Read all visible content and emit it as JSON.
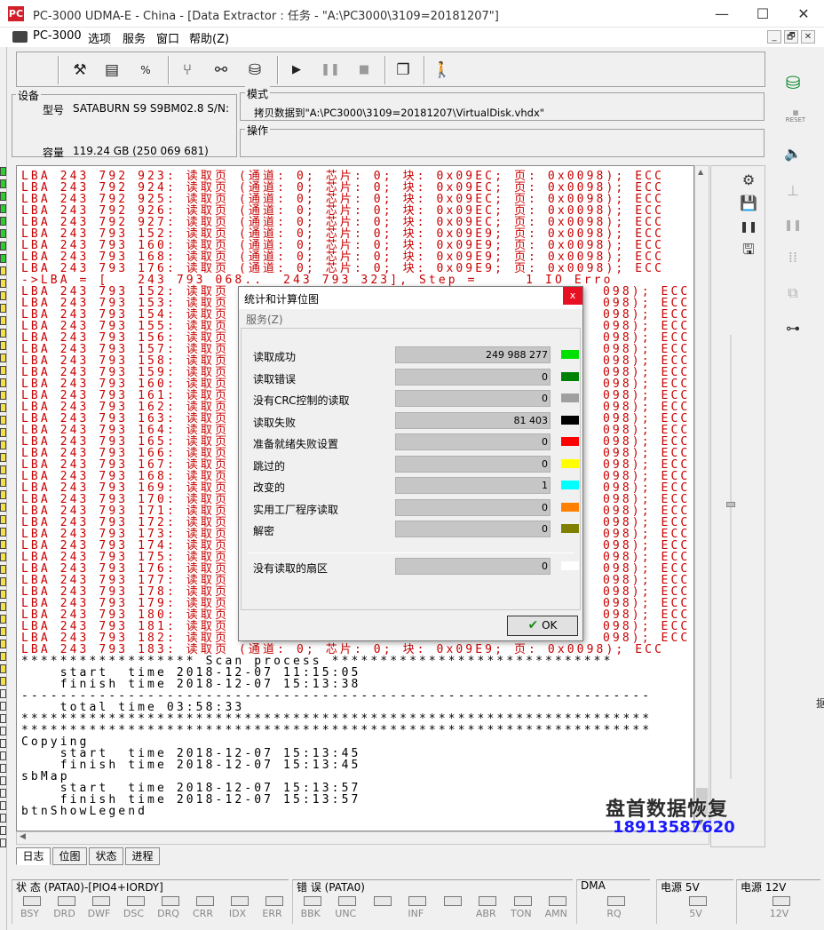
{
  "window": {
    "app_icon": "PC",
    "title": "PC-3000 UDMA-E - China - [Data Extractor : 任务 - \"A:\\PC3000\\3109=20181207\"]",
    "minimize": "—",
    "maximize": "☐",
    "close": "✕"
  },
  "menu": {
    "items": [
      "PC-3000",
      "选项",
      "服务",
      "窗口",
      "帮助(Z)"
    ],
    "mdi_buttons": [
      "_",
      "🗗",
      "✕"
    ]
  },
  "toolbar": {
    "icons": [
      "tools-icon",
      "save-disk-icon",
      "percent-icon",
      "fork-icon",
      "binoculars-icon",
      "disk-arrow-icon",
      "play-icon",
      "pause-icon",
      "stop-icon",
      "windows-icon",
      "walker-icon"
    ]
  },
  "device": {
    "group_label": "设备",
    "model_label": "型号",
    "model_value": "SATABURN   S9 S9BM02.8 S/N:",
    "capacity_label": "容量",
    "capacity_value": "119.24 GB (250 069 681)"
  },
  "mode": {
    "group_label": "模式",
    "text": "拷贝数据到\"A:\\PC3000\\3109=20181207\\VirtualDisk.vhdx\""
  },
  "operation": {
    "group_label": "操作"
  },
  "log": {
    "lines": [
      {
        "text": "LBA 243 792 923: 读取页 (通道: 0; 芯片: 0; 块: 0x09EC; 页: 0x0098); ECC",
        "color": "red"
      },
      {
        "text": "LBA 243 792 924: 读取页 (通道: 0; 芯片: 0; 块: 0x09EC; 页: 0x0098); ECC",
        "color": "red"
      },
      {
        "text": "LBA 243 792 925: 读取页 (通道: 0; 芯片: 0; 块: 0x09EC; 页: 0x0098); ECC",
        "color": "red"
      },
      {
        "text": "LBA 243 792 926: 读取页 (通道: 0; 芯片: 0; 块: 0x09EC; 页: 0x0098); ECC",
        "color": "red"
      },
      {
        "text": "LBA 243 792 927: 读取页 (通道: 0; 芯片: 0; 块: 0x09EC; 页: 0x0098); ECC",
        "color": "red"
      },
      {
        "text": "LBA 243 793 152: 读取页 (通道: 0; 芯片: 0; 块: 0x09E9; 页: 0x0098); ECC",
        "color": "red"
      },
      {
        "text": "LBA 243 793 160: 读取页 (通道: 0; 芯片: 0; 块: 0x09E9; 页: 0x0098); ECC",
        "color": "red"
      },
      {
        "text": "LBA 243 793 168: 读取页 (通道: 0; 芯片: 0; 块: 0x09E9; 页: 0x0098); ECC",
        "color": "red"
      },
      {
        "text": "LBA 243 793 176: 读取页 (通道: 0; 芯片: 0; 块: 0x09E9; 页: 0x0098); ECC",
        "color": "red"
      },
      {
        "text": "->LBA = [   243 793 068..  243 793 323], Step =     1 IO Erro",
        "color": "red"
      },
      {
        "text": "LBA 243 793 152: 读取页",
        "color": "red",
        "tail": "098); ECC"
      },
      {
        "text": "LBA 243 793 153: 读取页",
        "color": "red",
        "tail": "098); ECC"
      },
      {
        "text": "LBA 243 793 154: 读取页",
        "color": "red",
        "tail": "098); ECC"
      },
      {
        "text": "LBA 243 793 155: 读取页",
        "color": "red",
        "tail": "098); ECC"
      },
      {
        "text": "LBA 243 793 156: 读取页",
        "color": "red",
        "tail": "098); ECC"
      },
      {
        "text": "LBA 243 793 157: 读取页",
        "color": "red",
        "tail": "098); ECC"
      },
      {
        "text": "LBA 243 793 158: 读取页",
        "color": "red",
        "tail": "098); ECC"
      },
      {
        "text": "LBA 243 793 159: 读取页",
        "color": "red",
        "tail": "098); ECC"
      },
      {
        "text": "LBA 243 793 160: 读取页",
        "color": "red",
        "tail": "098); ECC"
      },
      {
        "text": "LBA 243 793 161: 读取页",
        "color": "red",
        "tail": "098); ECC"
      },
      {
        "text": "LBA 243 793 162: 读取页",
        "color": "red",
        "tail": "098); ECC"
      },
      {
        "text": "LBA 243 793 163: 读取页",
        "color": "red",
        "tail": "098); ECC"
      },
      {
        "text": "LBA 243 793 164: 读取页",
        "color": "red",
        "tail": "098); ECC"
      },
      {
        "text": "LBA 243 793 165: 读取页",
        "color": "red",
        "tail": "098); ECC"
      },
      {
        "text": "LBA 243 793 166: 读取页",
        "color": "red",
        "tail": "098); ECC"
      },
      {
        "text": "LBA 243 793 167: 读取页",
        "color": "red",
        "tail": "098); ECC"
      },
      {
        "text": "LBA 243 793 168: 读取页",
        "color": "red",
        "tail": "098); ECC"
      },
      {
        "text": "LBA 243 793 169: 读取页",
        "color": "red",
        "tail": "098); ECC"
      },
      {
        "text": "LBA 243 793 170: 读取页",
        "color": "red",
        "tail": "098); ECC"
      },
      {
        "text": "LBA 243 793 171: 读取页",
        "color": "red",
        "tail": "098); ECC"
      },
      {
        "text": "LBA 243 793 172: 读取页",
        "color": "red",
        "tail": "098); ECC"
      },
      {
        "text": "LBA 243 793 173: 读取页",
        "color": "red",
        "tail": "098); ECC"
      },
      {
        "text": "LBA 243 793 174: 读取页",
        "color": "red",
        "tail": "098); ECC"
      },
      {
        "text": "LBA 243 793 175: 读取页",
        "color": "red",
        "tail": "098); ECC"
      },
      {
        "text": "LBA 243 793 176: 读取页",
        "color": "red",
        "tail": "098); ECC"
      },
      {
        "text": "LBA 243 793 177: 读取页",
        "color": "red",
        "tail": "098); ECC"
      },
      {
        "text": "LBA 243 793 178: 读取页",
        "color": "red",
        "tail": "098); ECC"
      },
      {
        "text": "LBA 243 793 179: 读取页",
        "color": "red",
        "tail": "098); ECC"
      },
      {
        "text": "LBA 243 793 180: 读取页",
        "color": "red",
        "tail": "098); ECC"
      },
      {
        "text": "LBA 243 793 181: 读取页",
        "color": "red",
        "tail": "098); ECC"
      },
      {
        "text": "LBA 243 793 182: 读取页",
        "color": "red",
        "tail": "098); ECC"
      },
      {
        "text": "LBA 243 793 183: 读取页 (通道: 0; 芯片: 0; 块: 0x09E9; 页: 0x0098); ECC",
        "color": "red"
      },
      {
        "text": "****************** Scan process *****************************",
        "color": "black"
      },
      {
        "text": "    start  time 2018-12-07 11:15:05",
        "color": "black"
      },
      {
        "text": "    finish time 2018-12-07 15:13:38",
        "color": "black"
      },
      {
        "text": "-----------------------------------------------------------------",
        "color": "black"
      },
      {
        "text": "    total time 03:58:33",
        "color": "black"
      },
      {
        "text": "*****************************************************************",
        "color": "black"
      },
      {
        "text": "*****************************************************************",
        "color": "black"
      },
      {
        "text": "Copying",
        "color": "black"
      },
      {
        "text": "    start  time 2018-12-07 15:13:45",
        "color": "black"
      },
      {
        "text": "    finish time 2018-12-07 15:13:45",
        "color": "black"
      },
      {
        "text": "sbMap",
        "color": "black"
      },
      {
        "text": "    start  time 2018-12-07 15:13:57",
        "color": "black"
      },
      {
        "text": "    finish time 2018-12-07 15:13:57",
        "color": "black"
      },
      {
        "text": "btnShowLegend",
        "color": "black"
      }
    ]
  },
  "tabs": [
    "日志",
    "位图",
    "状态",
    "进程"
  ],
  "dialog": {
    "title": "统计和计算位图",
    "close": "x",
    "menu": "服务(Z)",
    "stats": [
      {
        "label": "读取成功",
        "value": "249 988 277",
        "color": "#00e000"
      },
      {
        "label": "读取错误",
        "value": "0",
        "color": "#008000"
      },
      {
        "label": "没有CRC控制的读取",
        "value": "0",
        "color": "#a0a0a0"
      },
      {
        "label": "读取失败",
        "value": "81 403",
        "color": "#000000"
      },
      {
        "label": "准备就绪失败设置",
        "value": "0",
        "color": "#ff0000"
      },
      {
        "label": "跳过的",
        "value": "0",
        "color": "#ffff00"
      },
      {
        "label": "改变的",
        "value": "1",
        "color": "#00ffff"
      },
      {
        "label": "实用工厂程序读取",
        "value": "0",
        "color": "#ff8000"
      },
      {
        "label": "解密",
        "value": "0",
        "color": "#808000"
      }
    ],
    "unread": {
      "label": "没有读取的扇区",
      "value": "0",
      "color": "#ffffff"
    },
    "ok_label": "OK",
    "ok_icon": "✔"
  },
  "status": {
    "state_header": "状 态 (PATA0)-[PIO4+IORDY]",
    "state_leds": [
      "BSY",
      "DRD",
      "DWF",
      "DSC",
      "DRQ",
      "CRR",
      "IDX",
      "ERR"
    ],
    "error_header": "错 误 (PATA0)",
    "error_leds": [
      "BBK",
      "UNC",
      "",
      "INF",
      "",
      "ABR",
      "TON",
      "AMN"
    ],
    "dma_header": "DMA",
    "dma_leds": [
      "RQ"
    ],
    "power5_header": "电源 5V",
    "power5_leds": [
      "5V"
    ],
    "power12_header": "电源 12V",
    "power12_leds": [
      "12V"
    ]
  },
  "sidebar": {
    "icons": [
      "drive-power-icon",
      "reset-icon",
      "speaker-icon",
      "jumper-icon",
      "pause-icon",
      "pins-icon",
      "cross-copy-icon",
      "connector-icon"
    ],
    "reset_label": "RESET"
  },
  "log_tools": {
    "icons": [
      "settings-icon",
      "save-icon",
      "pause-icon",
      "save-as-icon"
    ]
  },
  "watermark": {
    "line1": "盘首数据恢复",
    "line2": "18913587620"
  },
  "edge_char": "据"
}
